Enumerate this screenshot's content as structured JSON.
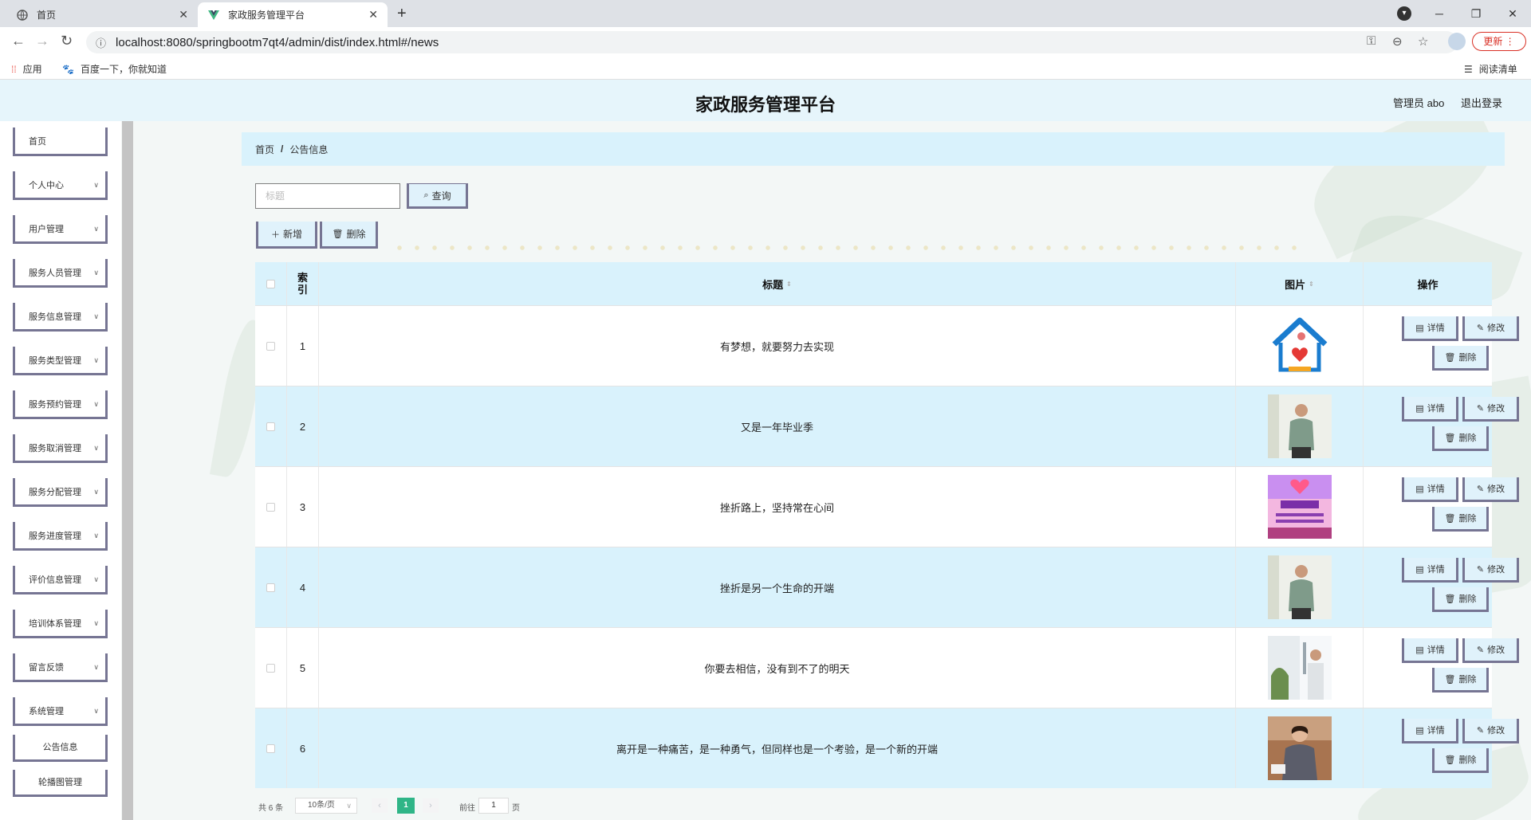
{
  "browser": {
    "tabs": [
      {
        "label": "首页",
        "active": false
      },
      {
        "label": "家政服务管理平台",
        "active": true
      }
    ],
    "url": "localhost:8080/springbootm7qt4/admin/dist/index.html#/news",
    "update_label": "更新",
    "bookmarks": {
      "apps": "应用",
      "baidu": "百度一下，你就知道",
      "reading_list": "阅读清单"
    }
  },
  "header": {
    "title": "家政服务管理平台",
    "user": "管理员 abo",
    "logout": "退出登录"
  },
  "sidebar": {
    "items": [
      {
        "label": "首页",
        "expandable": false
      },
      {
        "label": "个人中心",
        "expandable": true
      },
      {
        "label": "用户管理",
        "expandable": true
      },
      {
        "label": "服务人员管理",
        "expandable": true
      },
      {
        "label": "服务信息管理",
        "expandable": true
      },
      {
        "label": "服务类型管理",
        "expandable": true
      },
      {
        "label": "服务预约管理",
        "expandable": true
      },
      {
        "label": "服务取消管理",
        "expandable": true
      },
      {
        "label": "服务分配管理",
        "expandable": true
      },
      {
        "label": "服务进度管理",
        "expandable": true
      },
      {
        "label": "评价信息管理",
        "expandable": true
      },
      {
        "label": "培训体系管理",
        "expandable": true
      },
      {
        "label": "留言反馈",
        "expandable": true
      },
      {
        "label": "系统管理",
        "expandable": true
      }
    ],
    "subitems": [
      {
        "label": "公告信息"
      },
      {
        "label": "轮播图管理"
      }
    ]
  },
  "breadcrumb": {
    "home": "首页",
    "separator": "/",
    "current": "公告信息"
  },
  "search": {
    "placeholder": "标题",
    "query_label": "查询"
  },
  "toolbar": {
    "add_label": "新增",
    "delete_label": "删除"
  },
  "table": {
    "headers": {
      "index": "索引",
      "title": "标题",
      "image": "图片",
      "actions": "操作"
    },
    "actions": {
      "detail": "详情",
      "edit": "修改",
      "delete": "删除"
    },
    "rows": [
      {
        "index": "1",
        "title": "有梦想，就要努力去实现",
        "image": "logo-house-icon"
      },
      {
        "index": "2",
        "title": "又是一年毕业季",
        "image": "person-photo"
      },
      {
        "index": "3",
        "title": "挫折路上，坚持常在心间",
        "image": "poster-photo"
      },
      {
        "index": "4",
        "title": "挫折是另一个生命的开端",
        "image": "person-photo"
      },
      {
        "index": "5",
        "title": "你要去相信，没有到不了的明天",
        "image": "window-cleaning-photo"
      },
      {
        "index": "6",
        "title": "离开是一种痛苦，是一种勇气，但同样也是一个考验，是一个新的开端",
        "image": "service-worker-photo"
      }
    ]
  },
  "pagination": {
    "total": "共 6 条",
    "page_size": "10条/页",
    "current_page": "1",
    "goto_label": "前往",
    "goto_value": "1",
    "page_unit": "页"
  },
  "colors": {
    "header_bg": "#e6f5fb",
    "row_alt": "#d9f2fc",
    "button_border": "#767593",
    "pager_active": "#2fb587"
  }
}
